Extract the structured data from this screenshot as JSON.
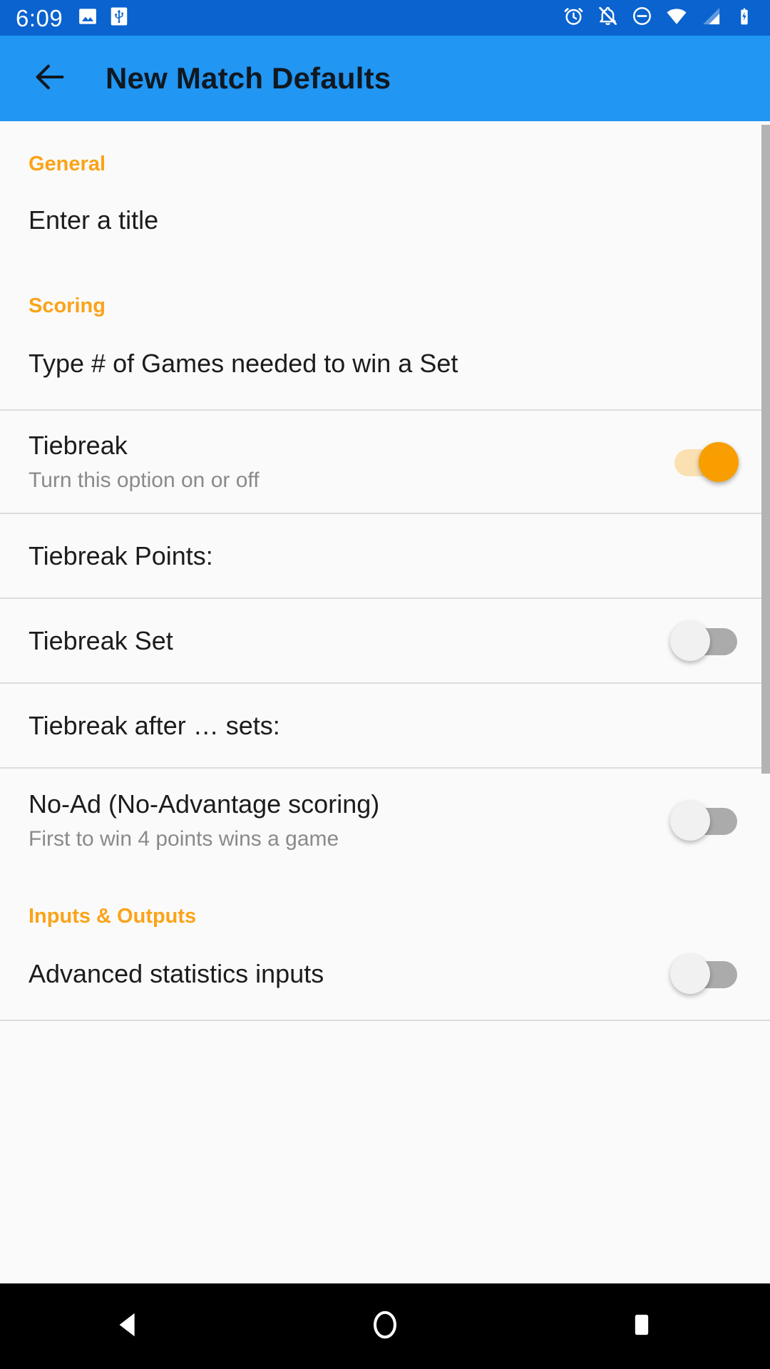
{
  "status_bar": {
    "time": "6:09",
    "background_color": "#0A63CE",
    "left_icons": [
      "image-icon",
      "usb-icon"
    ],
    "right_icons": [
      "alarm-icon",
      "notifications-off-icon",
      "do-not-disturb-icon",
      "wifi-icon",
      "cellular-signal-icon",
      "battery-charging-icon"
    ]
  },
  "app_bar": {
    "background_color": "#2196F3",
    "back_icon": "back-arrow-icon",
    "title": "New Match Defaults"
  },
  "accent_color": "#FBA318",
  "sections": [
    {
      "header": "General",
      "rows": [
        {
          "title": "Enter a title",
          "subtitle": "",
          "control": "none",
          "divider": "none"
        }
      ]
    },
    {
      "header": "Scoring",
      "rows": [
        {
          "title": "Type # of Games needed to win a Set",
          "subtitle": "",
          "control": "none",
          "divider": "inset"
        },
        {
          "title": "Tiebreak",
          "subtitle": "Turn this option on or off",
          "control": "switch-on",
          "divider": "inset"
        },
        {
          "title": "Tiebreak Points:",
          "subtitle": "",
          "control": "none",
          "divider": "inset"
        },
        {
          "title": "Tiebreak Set",
          "subtitle": "",
          "control": "switch-off",
          "divider": "inset"
        },
        {
          "title": "Tiebreak after … sets:",
          "subtitle": "",
          "control": "none",
          "divider": "full"
        },
        {
          "title": "No-Ad (No-Advantage scoring)",
          "subtitle": "First to win 4 points wins a game",
          "control": "switch-off",
          "divider": "none"
        }
      ]
    },
    {
      "header": "Inputs & Outputs",
      "rows": [
        {
          "title": "Advanced statistics inputs",
          "subtitle": "",
          "control": "switch-off",
          "divider": "full"
        }
      ]
    }
  ],
  "scrollbar": {
    "visible": true,
    "color": "#b3b3b3"
  },
  "nav_bar": {
    "background_color": "#000000",
    "buttons": [
      "back-nav-icon",
      "home-nav-icon",
      "recents-nav-icon"
    ]
  }
}
